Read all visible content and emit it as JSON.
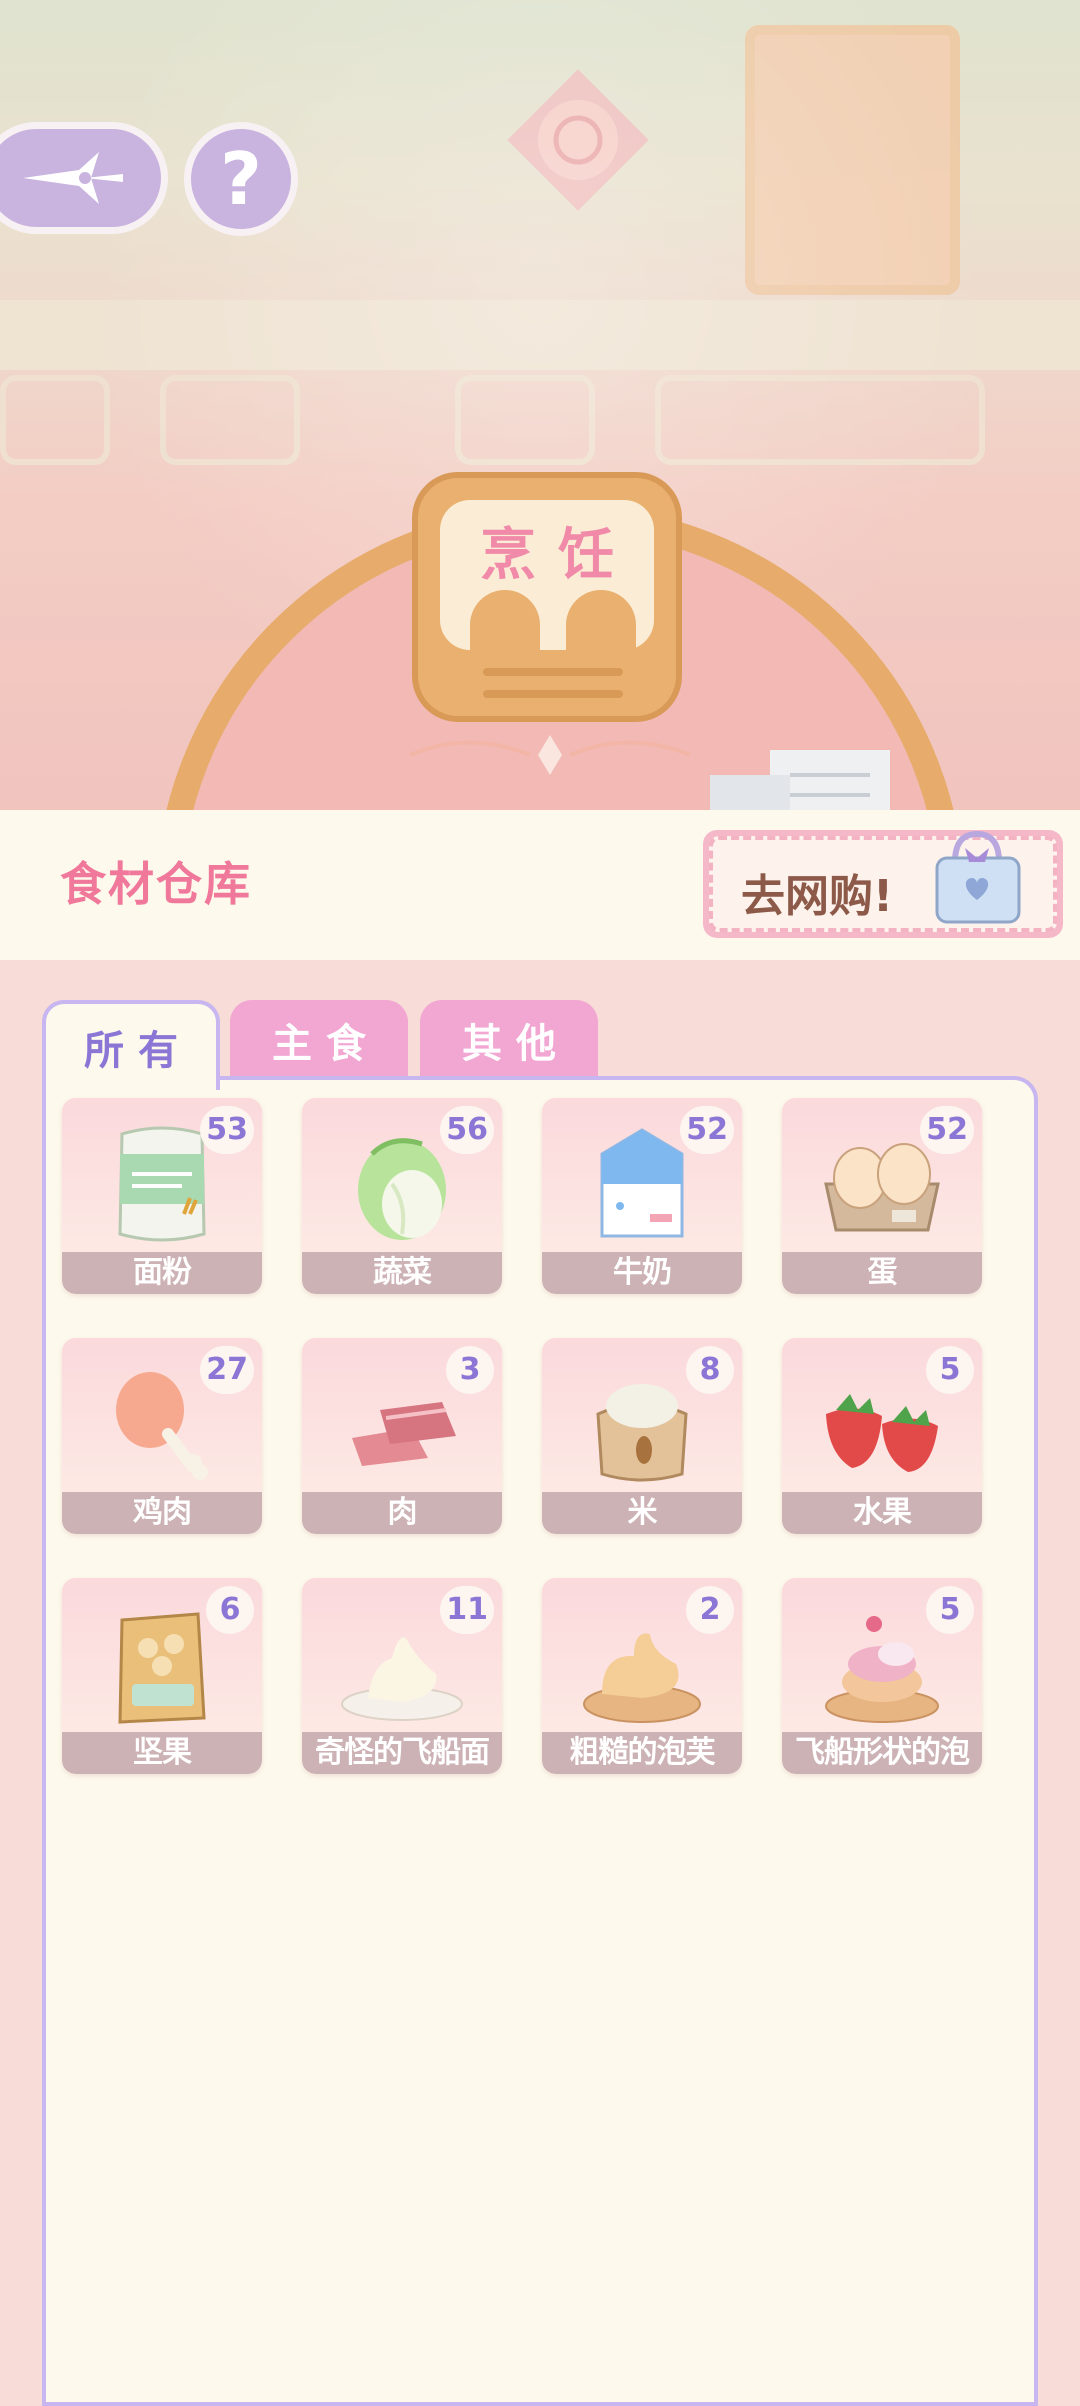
{
  "station": {
    "label": "烹饪"
  },
  "help": {
    "label": "?"
  },
  "storage": {
    "title": "食材仓库",
    "shop_label": "去网购!"
  },
  "tabs": [
    {
      "label": "所有",
      "active": true
    },
    {
      "label": "主食",
      "active": false
    },
    {
      "label": "其他",
      "active": false
    }
  ],
  "items": [
    {
      "name": "面粉",
      "count": "53",
      "icon": "flour-bag-icon"
    },
    {
      "name": "蔬菜",
      "count": "56",
      "icon": "cabbage-icon"
    },
    {
      "name": "牛奶",
      "count": "52",
      "icon": "milk-carton-icon"
    },
    {
      "name": "蛋",
      "count": "52",
      "icon": "egg-tray-icon"
    },
    {
      "name": "鸡肉",
      "count": "27",
      "icon": "chicken-leg-icon"
    },
    {
      "name": "肉",
      "count": "3",
      "icon": "meat-icon"
    },
    {
      "name": "米",
      "count": "8",
      "icon": "rice-sack-icon"
    },
    {
      "name": "水果",
      "count": "5",
      "icon": "strawberry-icon"
    },
    {
      "name": "坚果",
      "count": "6",
      "icon": "nuts-bag-icon"
    },
    {
      "name": "奇怪的飞船面",
      "count": "11",
      "icon": "dough-plate-icon"
    },
    {
      "name": "粗糙的泡芙",
      "count": "2",
      "icon": "puff-plate-icon"
    },
    {
      "name": "飞船形状的泡",
      "count": "5",
      "icon": "cream-puff-icon"
    }
  ],
  "colors": {
    "accent": "#8b76d6",
    "title": "#f0789a",
    "panel_border": "#c7b6ef"
  }
}
